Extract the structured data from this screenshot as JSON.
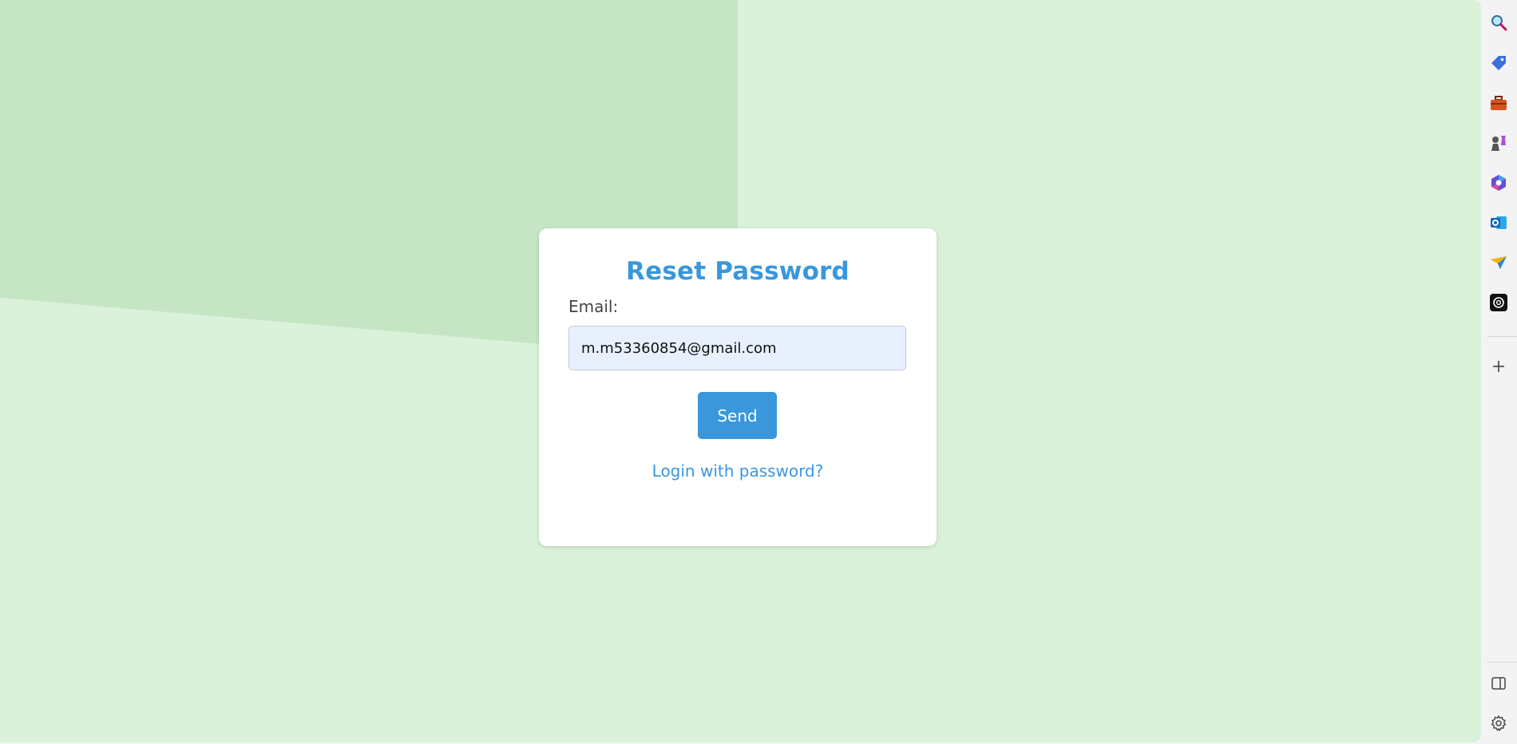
{
  "reset_form": {
    "title": "Reset Password",
    "email_label": "Email:",
    "email_value": "m.m53360854@gmail.com",
    "send_label": "Send",
    "login_link": "Login with password?"
  },
  "colors": {
    "accent": "#3a97dc",
    "background": "#daf1da",
    "background_shape": "#c5e5c5",
    "input_fill": "#e8f0fe"
  },
  "sidebar": {
    "icons": [
      "search-icon",
      "tag-icon",
      "toolbox-icon",
      "chess-icon",
      "copilot-icon",
      "outlook-icon",
      "send-icon",
      "openai-icon",
      "add-icon",
      "sidebar-toggle-icon",
      "gear-icon"
    ]
  }
}
